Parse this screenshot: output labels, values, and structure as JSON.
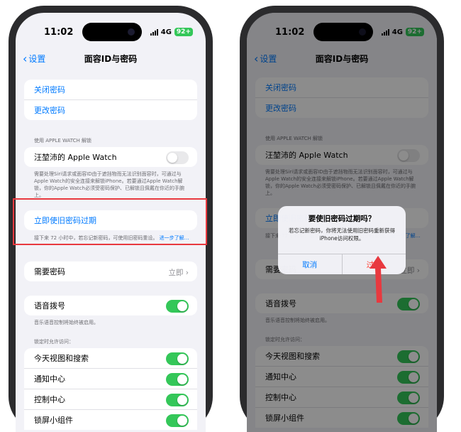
{
  "status": {
    "time": "11:02",
    "network": "4G",
    "battery": "92+"
  },
  "nav": {
    "back_label": "设置",
    "title": "面容ID与密码"
  },
  "passcode_group": {
    "turn_off": "关闭密码",
    "change": "更改密码"
  },
  "watch_section": {
    "header": "使用 APPLE WATCH 解锁",
    "watch_name": "汪堃沛的 Apple Watch",
    "footnote": "需要处理Siri请求或面容ID由于遮挡物而无法识别面容时，可通过与Apple Watch的安全连接来解锁iPhone。若要通过Apple Watch解锁，你的Apple Watch必须受密码保护、已解锁且佩戴在你近的手腕上。"
  },
  "expire_section": {
    "button": "立即使旧密码过期",
    "footnote": "接下来 72 小时中，若忘记新密码，可使用旧密码重设。",
    "learn_more": "进一步了解…"
  },
  "require_passcode": {
    "label": "需要密码",
    "value": "立即"
  },
  "voice_dial": {
    "label": "语音拨号",
    "footnote": "音乐语音控制将始终被启用。"
  },
  "locked_access": {
    "header": "锁定时允许访问：",
    "items": [
      "今天视图和搜索",
      "通知中心",
      "控制中心",
      "锁屏小组件"
    ]
  },
  "alert": {
    "title": "要使旧密码过期吗？",
    "message": "若忘记新密码，你将无法使用旧密码重新获得iPhone访问权限。",
    "cancel": "取消",
    "expire": "过期"
  },
  "colors": {
    "accent": "#007aff",
    "toggle_on": "#34c759",
    "destructive": "#ff3b30",
    "highlight": "#e8393f"
  }
}
